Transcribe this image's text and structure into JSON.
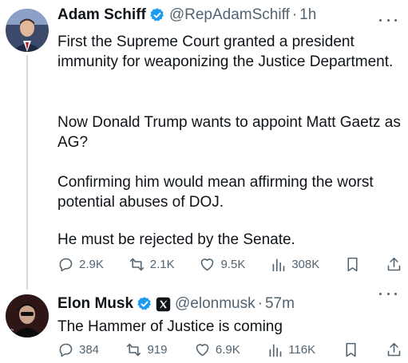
{
  "tweets": [
    {
      "author": {
        "name": "Adam Schiff",
        "handle": "@RepAdamSchiff",
        "time": "1h"
      },
      "paragraphs": [
        "First the Supreme Court granted a president immunity for weaponizing the Justice Department.",
        "Now Donald Trump wants to appoint Matt Gaetz as AG?",
        "Confirming him would mean affirming the worst potential abuses of DOJ.",
        "He must be rejected by the Senate."
      ],
      "stats": {
        "replies": "2.9K",
        "reposts": "2.1K",
        "likes": "9.5K",
        "views": "308K"
      }
    },
    {
      "author": {
        "name": "Elon Musk",
        "handle": "@elonmusk",
        "time": "57m"
      },
      "paragraphs": [
        "The Hammer of Justice is coming"
      ],
      "stats": {
        "replies": "384",
        "reposts": "919",
        "likes": "6.9K",
        "views": "116K"
      }
    }
  ],
  "colors": {
    "verified": "#1d9bf0",
    "text": "#0f1419",
    "secondary": "#536471",
    "thread": "#cfd9de"
  }
}
